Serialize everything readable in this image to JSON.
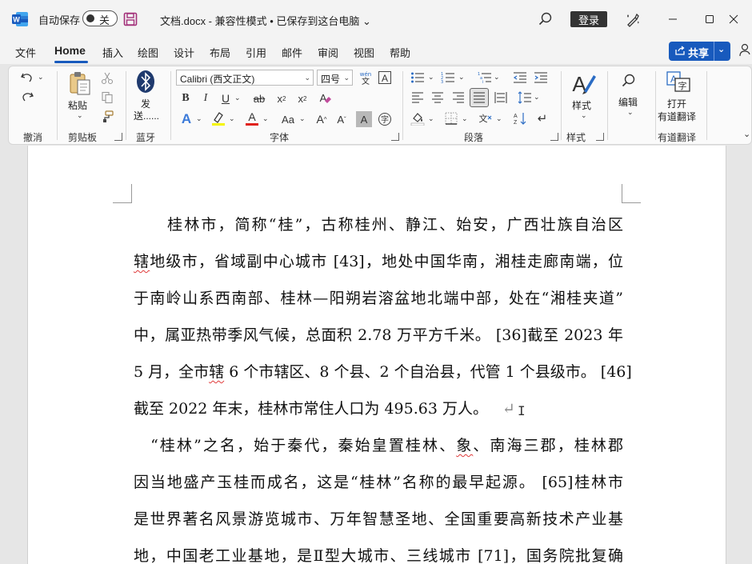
{
  "titlebar": {
    "autosave_label": "自动保存",
    "autosave_state": "关",
    "doc_title": "文档.docx  -  兼容性模式 • 已保存到这台电脑 ⌄",
    "login_label": "登录"
  },
  "tabs": [
    "文件",
    "Home",
    "插入",
    "绘图",
    "设计",
    "布局",
    "引用",
    "邮件",
    "审阅",
    "视图",
    "帮助"
  ],
  "share_label": "共享",
  "ribbon": {
    "groups": {
      "undo": "撤消",
      "clipboard": "剪贴板",
      "bluetooth": "蓝牙",
      "font": "字体",
      "paragraph": "段落",
      "styles": "样式",
      "translate": "有道翻译"
    },
    "paste_label": "粘贴",
    "send_label_1": "发",
    "send_label_2": "送......",
    "font_name": "Calibri (西文正文)",
    "font_size": "四号",
    "styles_label": "样式",
    "edit_label": "编辑",
    "translate_label_1": "打开",
    "translate_label_2": "有道翻译"
  },
  "document": {
    "lines": [
      "　　桂林市，简称“桂”，古称桂州、静江、始安，广西壮族自治区",
      "辖地级市，省域副中心城市 [43]，地处中国华南，湘桂走廊南端，位",
      "于南岭山系西南部、桂林—阳朔岩溶盆地北端中部，处在“湘桂夹道”",
      "中，属亚热带季风气候，总面积 2.78 万平方千米。 [36]截至 2023 年",
      "5 月，全市辖 6 个市辖区、8 个县、2 个自治县，代管 1 个县级市。 [46]",
      "截至 2022 年末，桂林市常住人口为 495.63 万人。",
      "　“桂林”之名，始于秦代，秦始皇置桂林、象、南海三郡，桂林郡",
      "因当地盛产玉桂而成名，这是“桂林”名称的最早起源。 [65]桂林市",
      "是世界著名风景游览城市、万年智慧圣地、全国重要高新技术产业基",
      "地，中国老工业基地，是Ⅱ型大城市、三线城市 [71]，国务院批复确"
    ],
    "paragraph_mark": "↵"
  }
}
